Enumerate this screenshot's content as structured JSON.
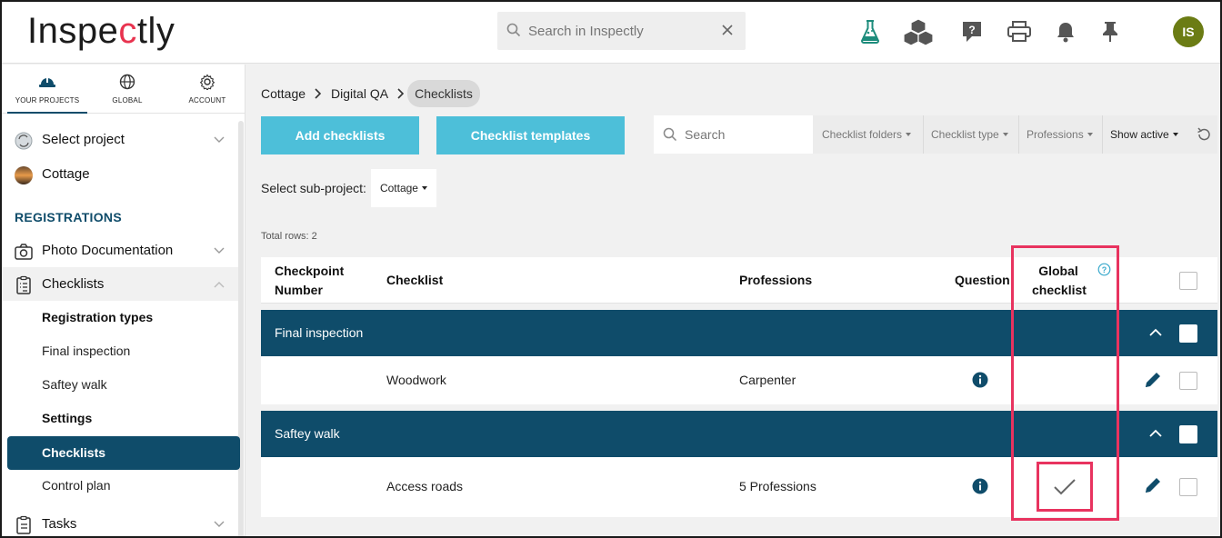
{
  "header": {
    "logo_pre": "Inspe",
    "logo_c": "c",
    "logo_post": "tly",
    "search_placeholder": "Search in Inspectly",
    "avatar_initials": "IS",
    "icons": [
      "flask-icon",
      "cubes-icon",
      "help-icon",
      "print-icon",
      "bell-icon",
      "pin-icon"
    ]
  },
  "sidebar": {
    "tabs": [
      {
        "label": "YOUR PROJECTS",
        "icon": "hardhat-icon"
      },
      {
        "label": "GLOBAL",
        "icon": "globe-icon"
      },
      {
        "label": "ACCOUNT",
        "icon": "gear-icon"
      }
    ],
    "select_project": "Select project",
    "project": "Cottage",
    "section": "REGISTRATIONS",
    "items": [
      {
        "label": "Photo Documentation"
      },
      {
        "label": "Checklists"
      },
      {
        "label": "Registration types"
      },
      {
        "label": "Final inspection"
      },
      {
        "label": "Saftey walk"
      },
      {
        "label": "Settings"
      },
      {
        "label": "Checklists"
      },
      {
        "label": "Control plan"
      },
      {
        "label": "Tasks"
      }
    ]
  },
  "breadcrumb": [
    "Cottage",
    "Digital QA",
    "Checklists"
  ],
  "buttons": {
    "add": "Add checklists",
    "templates": "Checklist templates"
  },
  "filters": {
    "search_placeholder": "Search",
    "folders": "Checklist folders",
    "type": "Checklist type",
    "professions": "Professions",
    "active": "Show active"
  },
  "subproject": {
    "label": "Select sub-project:",
    "value": "Cottage"
  },
  "total_rows": "Total rows: 2",
  "table": {
    "headers": {
      "checkpoint_1": "Checkpoint",
      "checkpoint_2": "Number",
      "checklist": "Checklist",
      "professions": "Professions",
      "question": "Question",
      "global_1": "Global",
      "global_2": "checklist"
    },
    "groups": [
      {
        "name": "Final inspection",
        "rows": [
          {
            "checklist": "Woodwork",
            "professions": "Carpenter",
            "global": false
          }
        ]
      },
      {
        "name": "Saftey walk",
        "rows": [
          {
            "checklist": "Access roads",
            "professions": "5 Professions",
            "global": true
          }
        ]
      }
    ]
  },
  "colors": {
    "primary": "#0f4c6a",
    "button": "#4dbfd9",
    "highlight": "#e8335f",
    "avatar": "#6b7c14"
  }
}
